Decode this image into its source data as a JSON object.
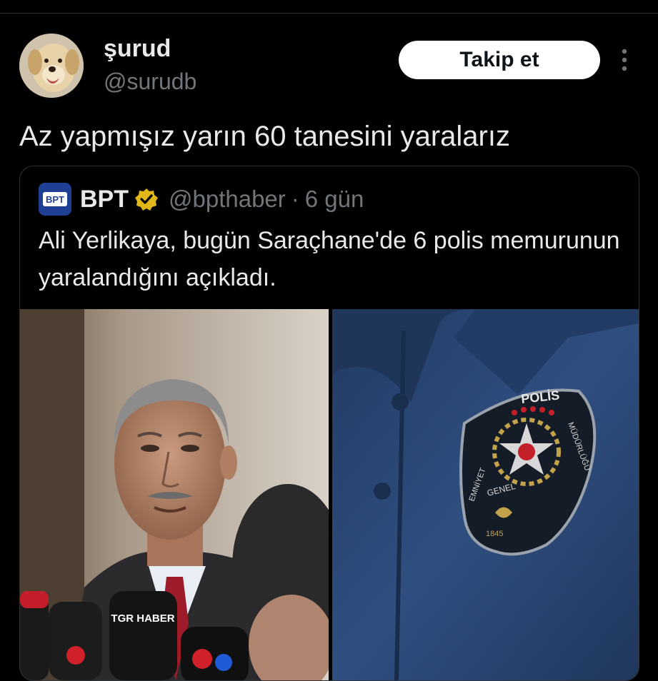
{
  "author": {
    "display_name": "şurud",
    "handle": "@surudb"
  },
  "follow_label": "Takip et",
  "tweet_text": "Az yapmışız yarın 60 tanesini yaralarız",
  "quoted": {
    "avatar_text": "BPT",
    "display_name": "BPT",
    "handle": "@bpthaber",
    "separator": "·",
    "time": "6 gün",
    "text": "Ali Yerlikaya, bugün Saraçhane'de 6 polis memurunun yaralandığını açıkladı.",
    "photo_left": {
      "mic_label": "TGR HABER"
    },
    "photo_right": {
      "patch_top": "POLİS",
      "patch_left": "EMNİYET",
      "patch_right": "MÜDÜRLÜĞÜ",
      "patch_bottom": "GENEL",
      "patch_year": "1845"
    }
  },
  "colors": {
    "background": "#000000",
    "text": "#e7e9ea",
    "muted": "#71767b",
    "border": "#2f3336",
    "verified_gold": "#e2b719",
    "shirt_blue": "#2c4a78"
  },
  "icons": {
    "more": "more-vertical-icon",
    "verified": "verified-gold-badge-icon"
  }
}
